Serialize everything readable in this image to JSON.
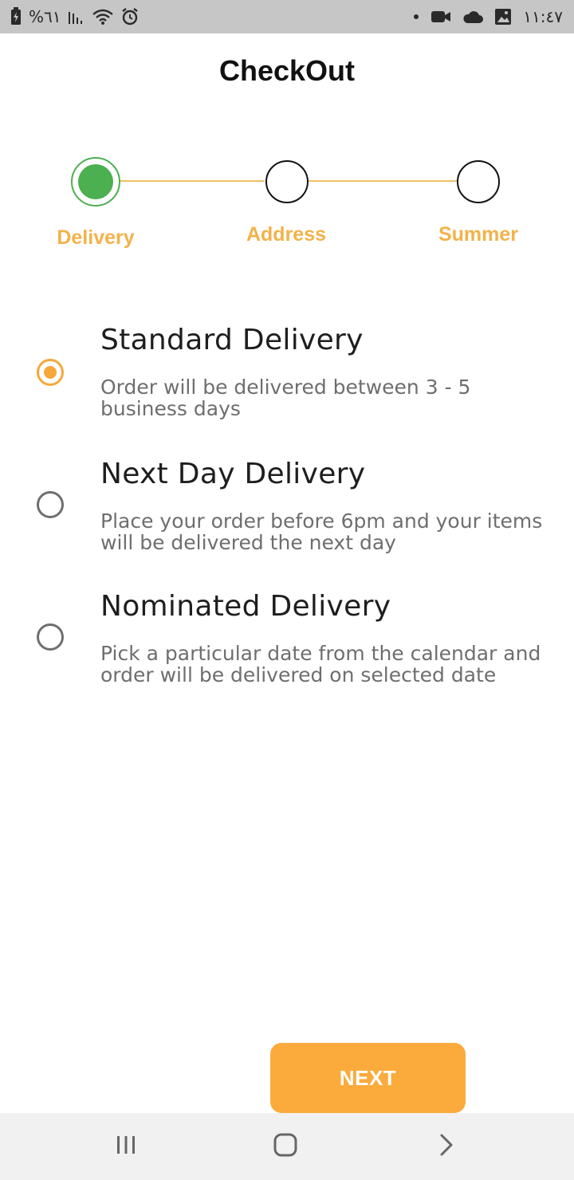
{
  "status_bar": {
    "battery_text": "%٦١",
    "time": "١١:٤٧"
  },
  "page": {
    "title": "CheckOut"
  },
  "stepper": {
    "steps": [
      {
        "label": "Delivery",
        "state": "active"
      },
      {
        "label": "Address",
        "state": "inactive"
      },
      {
        "label": "Summer",
        "state": "inactive"
      }
    ]
  },
  "delivery_options": [
    {
      "title": "Standard Delivery",
      "description": "Order will be delivered between 3 - 5 business days",
      "selected": true
    },
    {
      "title": "Next Day Delivery",
      "description": "Place your order before 6pm and your items will be delivered the next day",
      "selected": false
    },
    {
      "title": "Nominated Delivery",
      "description": "Pick a particular date from the calendar and order will be delivered on selected date",
      "selected": false
    }
  ],
  "actions": {
    "next_label": "NEXT"
  },
  "nav_bar": {
    "icons": [
      "recent-apps-icon",
      "home-icon",
      "back-icon"
    ]
  },
  "colors": {
    "accent": "#fbab3c",
    "step_active": "#4caf50",
    "step_label": "#f2b24a",
    "status_bar_bg": "#c6c6c6"
  }
}
